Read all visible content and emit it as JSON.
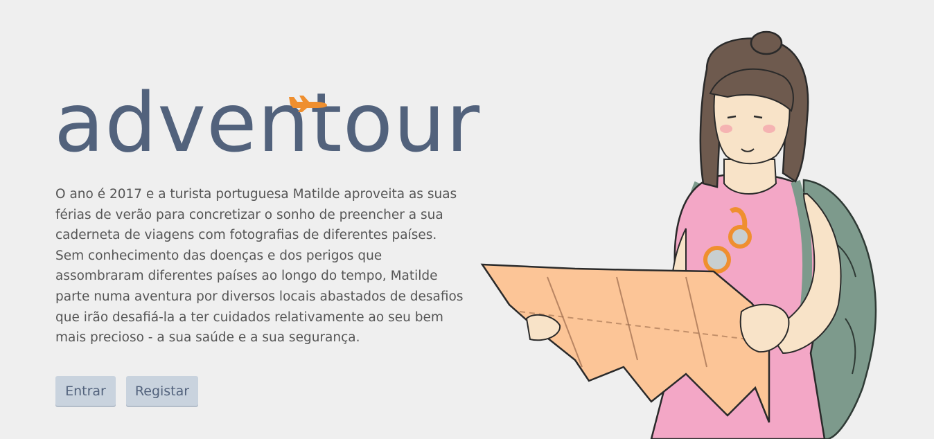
{
  "brand": {
    "name": "adventour",
    "color": "#52627c",
    "accent": "#ef8f2f",
    "icon": "plane-icon"
  },
  "intro": {
    "text": "O ano é 2017 e a turista portuguesa Matilde aproveita as suas férias de verão para concretizar o sonho de preencher a sua caderneta de viagens com fotografias de diferentes países. Sem conhecimento das doenças e dos perigos que assombraram diferentes países ao longo do tempo, Matilde parte numa aventura por diversos locais abastados de desafios que irão desafiá-la a ter cuidados relativamente ao seu bem mais precioso - a sua saúde e a sua segurança."
  },
  "actions": {
    "login_label": "Entrar",
    "register_label": "Registar"
  },
  "colors": {
    "background": "#efefef",
    "button_bg": "#c9d3de",
    "text": "#555555"
  }
}
